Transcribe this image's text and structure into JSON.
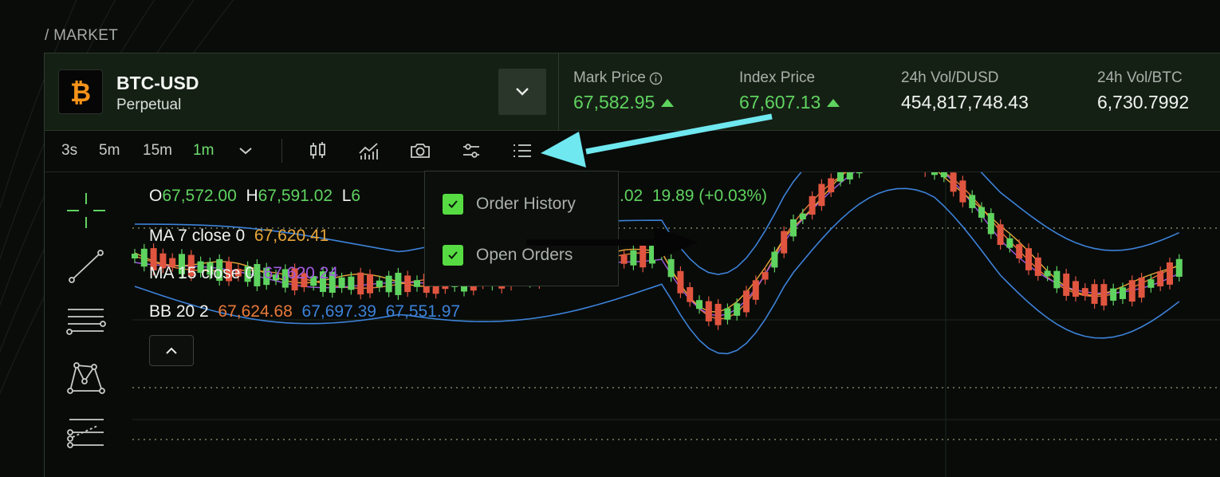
{
  "breadcrumb": "/ MARKET",
  "market": {
    "pair": "BTC-USD",
    "type": "Perpetual",
    "stats": [
      {
        "label": "Mark Price",
        "value": "67,582.95",
        "trend": "up",
        "info": true,
        "color": "green"
      },
      {
        "label": "Index Price",
        "value": "67,607.13",
        "trend": "up",
        "info": false,
        "color": "green"
      },
      {
        "label": "24h Vol/DUSD",
        "value": "454,817,748.43",
        "trend": "",
        "info": false,
        "color": "white"
      },
      {
        "label": "24h Vol/BTC",
        "value": "6,730.7992",
        "trend": "",
        "info": false,
        "color": "white"
      }
    ]
  },
  "toolbar": {
    "timeframes": [
      "3s",
      "5m",
      "15m",
      "1m"
    ],
    "active_timeframe": "1m",
    "icons": [
      "candlestick-icon",
      "indicator-chart-icon",
      "camera-icon",
      "settings-sliders-icon",
      "list-icon"
    ]
  },
  "legend": {
    "ohlc": {
      "o_label": "O",
      "o": "67,572.00",
      "h_label": "H",
      "h": "67,591.02",
      "l_label": "L",
      "l_partial": "6",
      "c_partial": ".02",
      "change": "19.89 (+0.03%)"
    },
    "ma7": {
      "label": "MA 7 close 0",
      "value": "67,620.41"
    },
    "ma15": {
      "label": "MA 15 close 0",
      "value": "67,620.24"
    },
    "bb": {
      "label": "BB 20 2",
      "mid": "67,624.68",
      "upper": "67,697.39",
      "lower": "67,551.97"
    }
  },
  "dropdown": {
    "items": [
      {
        "label": "Order History",
        "checked": true
      },
      {
        "label": "Open Orders",
        "checked": true
      }
    ]
  },
  "colors": {
    "up": "#5fd35f",
    "down": "#e0553f",
    "ma7": "#e8a73a",
    "ma15": "#a05ae0",
    "bb_mid": "#e87a3a",
    "bb_band": "#3c82d8",
    "annotation_arrow": "#6fe8f0"
  }
}
